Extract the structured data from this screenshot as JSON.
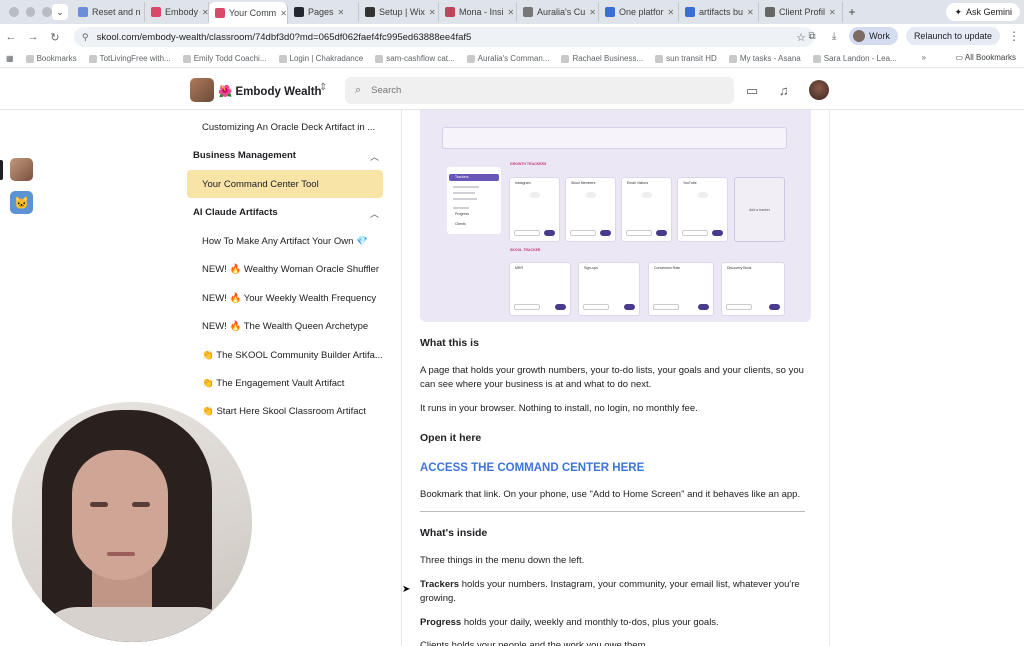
{
  "browser": {
    "tabs": [
      {
        "label": "Reset and n",
        "color": "#6a8fd6"
      },
      {
        "label": "Embody",
        "color": "#d84a6a"
      },
      {
        "label": "Your Comm",
        "color": "#d84a6a"
      },
      {
        "label": "Pages",
        "color": "#24292f"
      },
      {
        "label": "Setup | Wix",
        "color": "#333333"
      },
      {
        "label": "Mona - Insi",
        "color": "#c0445a"
      },
      {
        "label": "Auralia's Cu",
        "color": "#777777"
      },
      {
        "label": "One platfor",
        "color": "#3b6fd8"
      },
      {
        "label": "artifacts bu",
        "color": "#3b6fd8"
      },
      {
        "label": "Client Profil",
        "color": "#666666"
      }
    ],
    "active_tab_index": 2,
    "ask_gemini": "Ask Gemini",
    "url": "skool.com/embody-wealth/classroom/74dbf3d0?md=065df062faef4fc995ed63888ee4faf5",
    "profile_label": "Work",
    "relaunch_label": "Relaunch to update",
    "bookmarks": [
      "Bookmarks",
      "TotLivingFree with...",
      "Emily Todd Coachi...",
      "Login | Chakradance",
      "sam-cashflow cat...",
      "Auralia's Comman...",
      "Rachael Business...",
      "sun transit HD",
      "My tasks - Asana",
      "Sara Landon - Lea..."
    ],
    "all_bookmarks": "All Bookmarks"
  },
  "app": {
    "brand_name": "🌺 Embody Wealth",
    "search_placeholder": "Search"
  },
  "sidebar": {
    "top_lesson": "Customizing An Oracle Deck Artifact in ...",
    "sections": [
      {
        "title": "Business Management",
        "lessons": [
          "Your Command Center Tool"
        ]
      },
      {
        "title": "AI Claude Artifacts",
        "lessons": [
          "How To Make Any Artifact Your Own 💎",
          "NEW! 🔥 Wealthy Woman Oracle Shuffler",
          "NEW! 🔥 Your Weekly Wealth Frequency",
          "NEW! 🔥 The Wealth Queen Archetype",
          "👏 The SKOOL Community Builder Artifa...",
          "👏 The Engagement Vault Artifact",
          "👏 Start Here Skool Classroom Artifact"
        ]
      }
    ],
    "active_lesson": "Your Command Center Tool"
  },
  "preview": {
    "nav_items": [
      "Trackers",
      "Progress",
      "Clients"
    ],
    "section1": "GROWTH TRACKERS",
    "section2": "SKOOL TRACKER",
    "cards_row1": [
      "Instagram",
      "Skool Members",
      "Email Visitors",
      "YouTube"
    ],
    "cards_row2": [
      "MRR",
      "Sign-ups",
      "Conversion Rate",
      "Discovery Book"
    ],
    "add_label": "Add a tracker"
  },
  "content": {
    "h_what": "What this is",
    "p_what": "A page that holds your growth numbers, your to-do lists, your goals and your clients, so you can see where your business is at and what to do next.",
    "p_runs": "It runs in your browser. Nothing to install, no login, no monthly fee.",
    "h_open": "Open it here",
    "cta": "ACCESS THE COMMAND CENTER HERE",
    "p_bookmark": "Bookmark that link. On your phone, use \"Add to Home Screen\" and it behaves like an app.",
    "h_inside": "What's inside",
    "p_three": "Three things in the menu down the left.",
    "trackers_term": "Trackers",
    "trackers_text": " holds your numbers. Instagram, your community, your email list, whatever you're growing.",
    "progress_term": "Progress",
    "progress_text": " holds your daily, weekly and monthly to-dos, plus your goals.",
    "clients_partial": "Clients holds your people and the work you owe them."
  }
}
